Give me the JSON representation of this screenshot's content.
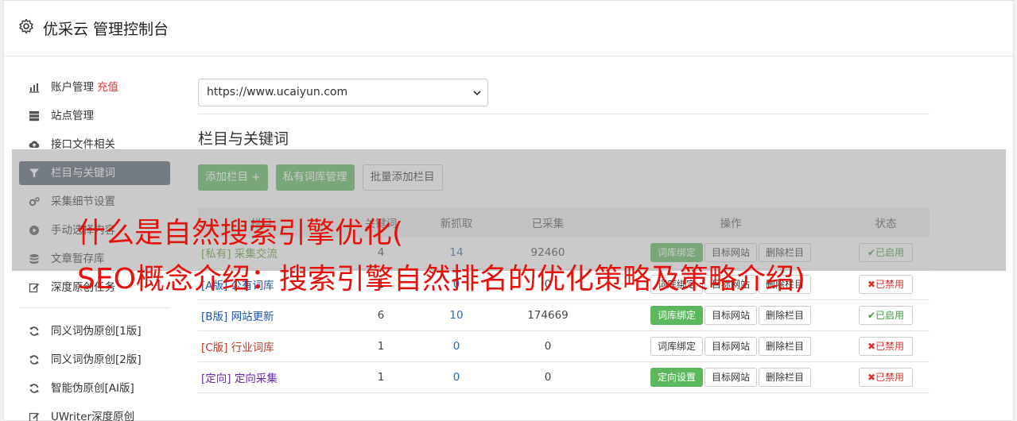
{
  "app": {
    "title": "优采云 管理控制台"
  },
  "sidebar": {
    "group1": [
      {
        "label": "账户管理",
        "extra": "充值",
        "icon": "bar-chart-icon"
      },
      {
        "label": "站点管理",
        "icon": "server-icon"
      },
      {
        "label": "接口文件相关",
        "icon": "cloud-upload-icon"
      },
      {
        "label": "栏目与关键词",
        "icon": "filter-icon",
        "active": true
      },
      {
        "label": "采集细节设置",
        "icon": "cogs-icon"
      },
      {
        "label": "手动选择内容",
        "icon": "play-circle-icon"
      },
      {
        "label": "文章暂存库",
        "icon": "database-icon"
      },
      {
        "label": "深度原创任务",
        "icon": "edit-icon"
      }
    ],
    "group2": [
      {
        "label": "同义词伪原创[1版]",
        "icon": "refresh-icon"
      },
      {
        "label": "同义词伪原创[2版]",
        "icon": "refresh-icon"
      },
      {
        "label": "智能伪原创[AI版]",
        "icon": "refresh-icon"
      },
      {
        "label": "UWriter深度原创",
        "icon": "edit-icon"
      }
    ]
  },
  "main": {
    "site_select": "https://www.ucaiyun.com",
    "section_title": "栏目与关键词",
    "buttons": {
      "add": "添加栏目 +",
      "private": "私有词库管理",
      "batch": "批量添加栏目"
    },
    "table": {
      "headers": {
        "name": "栏目",
        "keywords": "关键词",
        "new": "新抓取",
        "collected": "已采集",
        "ops": "操作",
        "status": "状态"
      },
      "rows": [
        {
          "name": "[私有] 采集交流",
          "color": "green",
          "kw": "4",
          "new": "14",
          "collected": "92460",
          "bind": "词库绑定",
          "bind_green": true,
          "target": "目标网站",
          "del": "删除栏目",
          "status": "✔已启用",
          "on": true
        },
        {
          "name": "[A版] 公有词库",
          "color": "blue",
          "kw": "1",
          "new": "0",
          "collected": "0",
          "bind": "词库绑定",
          "bind_green": false,
          "target": "目标网站",
          "del": "删除栏目",
          "status": "✖已禁用",
          "on": false
        },
        {
          "name": "[B版] 网站更新",
          "color": "blue",
          "kw": "6",
          "new": "10",
          "collected": "174669",
          "bind": "词库绑定",
          "bind_green": true,
          "target": "目标网站",
          "del": "删除栏目",
          "status": "✔已启用",
          "on": true
        },
        {
          "name": "[C版] 行业词库",
          "color": "red",
          "kw": "1",
          "new": "0",
          "collected": "0",
          "bind": "词库绑定",
          "bind_green": false,
          "target": "目标网站",
          "del": "删除栏目",
          "status": "✖已禁用",
          "on": false
        },
        {
          "name": "[定向] 定向采集",
          "color": "purple",
          "kw": "1",
          "new": "0",
          "collected": "0",
          "bind": "定向设置",
          "bind_green": true,
          "target": "目标网站",
          "del": "删除栏目",
          "status": "✖已禁用",
          "on": false
        }
      ]
    }
  },
  "overlay": {
    "line1": "什么是自然搜索引擎优化(",
    "line2": "SEO概念介绍：搜索引擎自然排名的优化策略及策略介绍)"
  },
  "colors": {
    "accent_green": "#5cb85c",
    "active_bg": "#54606f",
    "headline_red": "#e8100a",
    "recharge_red": "#e4393c"
  }
}
